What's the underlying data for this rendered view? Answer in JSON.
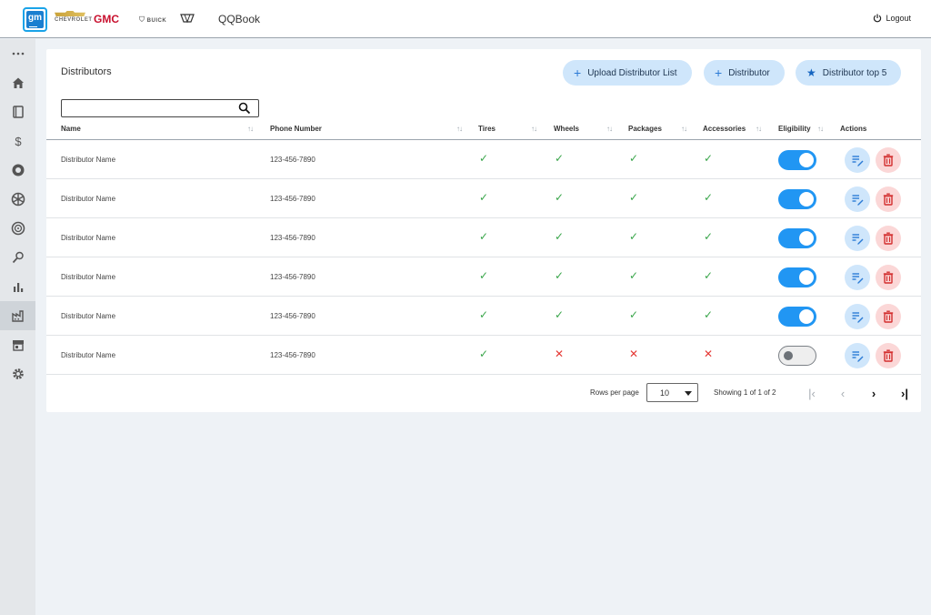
{
  "header": {
    "app_title": "QQBook",
    "logo_text": "gm",
    "brands": {
      "chevrolet": "CHEVROLET",
      "gmc": "GMC",
      "buick": "BUICK"
    },
    "logout_label": "Logout"
  },
  "sidebar": {
    "items": [
      {
        "icon": "more-icon",
        "active": false
      },
      {
        "icon": "home-icon",
        "active": false
      },
      {
        "icon": "book-icon",
        "active": false
      },
      {
        "icon": "dollar-icon",
        "active": false
      },
      {
        "icon": "tire-icon",
        "active": false
      },
      {
        "icon": "wheel-icon",
        "active": false
      },
      {
        "icon": "rim-icon",
        "active": false
      },
      {
        "icon": "wrench-icon",
        "active": false
      },
      {
        "icon": "bar-chart-icon",
        "active": false
      },
      {
        "icon": "factory-icon",
        "active": true
      },
      {
        "icon": "store-icon",
        "active": false
      },
      {
        "icon": "gear-icon",
        "active": false
      }
    ]
  },
  "page": {
    "title": "Distributors",
    "buttons": {
      "upload": "Upload Distributor List",
      "add": "Distributor",
      "top5": "Distributor top 5"
    },
    "search": {
      "value": "",
      "placeholder": ""
    }
  },
  "table": {
    "columns": {
      "name": "Name",
      "phone": "Phone Number",
      "tires": "Tires",
      "wheels": "Wheels",
      "packages": "Packages",
      "accessories": "Accessories",
      "eligibility": "Eligibility",
      "actions": "Actions"
    },
    "rows": [
      {
        "name": "Distributor Name",
        "phone": "123-456-7890",
        "tires": true,
        "wheels": true,
        "packages": true,
        "accessories": true,
        "eligible": true
      },
      {
        "name": "Distributor Name",
        "phone": "123-456-7890",
        "tires": true,
        "wheels": true,
        "packages": true,
        "accessories": true,
        "eligible": true
      },
      {
        "name": "Distributor Name",
        "phone": "123-456-7890",
        "tires": true,
        "wheels": true,
        "packages": true,
        "accessories": true,
        "eligible": true
      },
      {
        "name": "Distributor Name",
        "phone": "123-456-7890",
        "tires": true,
        "wheels": true,
        "packages": true,
        "accessories": true,
        "eligible": true
      },
      {
        "name": "Distributor Name",
        "phone": "123-456-7890",
        "tires": true,
        "wheels": true,
        "packages": true,
        "accessories": true,
        "eligible": true
      },
      {
        "name": "Distributor Name",
        "phone": "123-456-7890",
        "tires": true,
        "wheels": false,
        "packages": false,
        "accessories": false,
        "eligible": false
      }
    ],
    "marks": {
      "yes": "✓",
      "no": "✕"
    }
  },
  "pagination": {
    "rows_per_page_label": "Rows per page",
    "rows_per_page_value": "10",
    "showing": "Showing 1 of 1 of 2"
  },
  "colors": {
    "accent": "#2196f3",
    "pill_bg": "#cfe6fb",
    "delete_bg": "#fbd7d7",
    "check": "#3aa64b",
    "cross": "#e53935"
  }
}
